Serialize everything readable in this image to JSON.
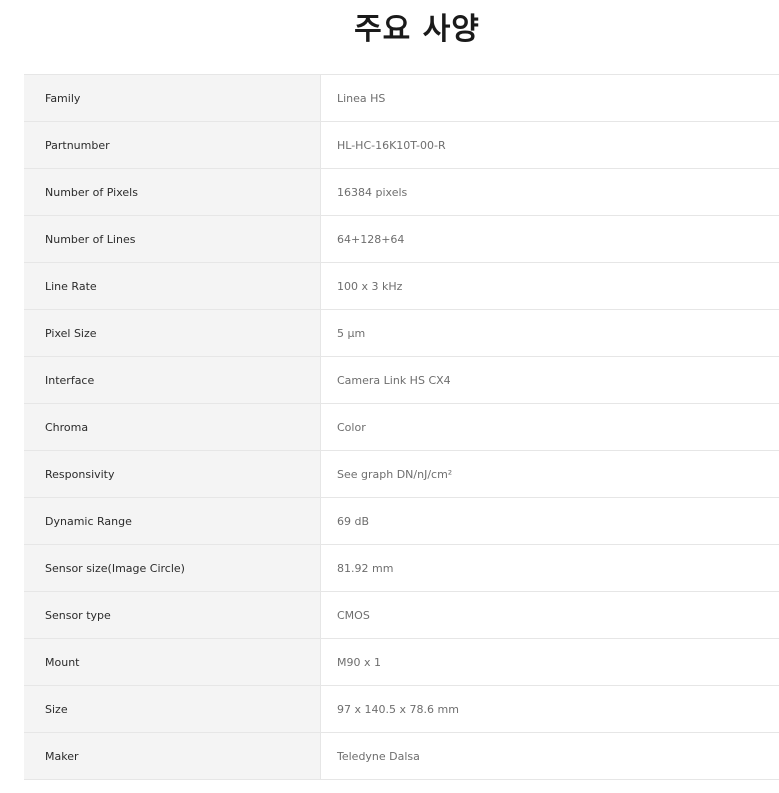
{
  "title": "주요 사양",
  "specs": [
    {
      "label": "Family",
      "value": "Linea HS"
    },
    {
      "label": "Partnumber",
      "value": "HL-HC-16K10T-00-R"
    },
    {
      "label": "Number of Pixels",
      "value": "16384 pixels"
    },
    {
      "label": "Number of Lines",
      "value": "64+128+64"
    },
    {
      "label": "Line Rate",
      "value": "100 x 3 kHz"
    },
    {
      "label": "Pixel Size",
      "value": "5 µm"
    },
    {
      "label": "Interface",
      "value": "Camera Link HS CX4"
    },
    {
      "label": "Chroma",
      "value": "Color"
    },
    {
      "label": "Responsivity",
      "value": "See graph DN/nJ/cm²"
    },
    {
      "label": "Dynamic Range",
      "value": "69 dB"
    },
    {
      "label": "Sensor size(Image Circle)",
      "value": "81.92 mm"
    },
    {
      "label": "Sensor type",
      "value": "CMOS"
    },
    {
      "label": "Mount",
      "value": "M90 x 1"
    },
    {
      "label": "Size",
      "value": "97 x 140.5 x 78.6 mm"
    },
    {
      "label": "Maker",
      "value": "Teledyne Dalsa"
    }
  ]
}
